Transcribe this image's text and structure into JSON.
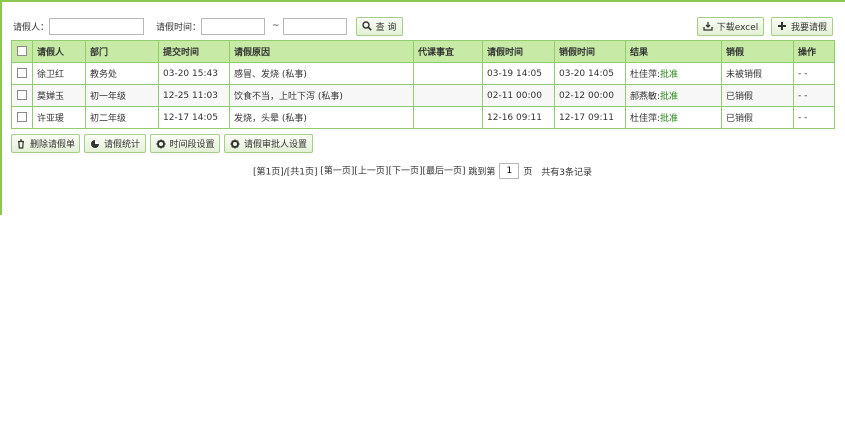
{
  "filter": {
    "applicant_label": "请假人：",
    "applicant_value": "",
    "time_label": "请假时间：",
    "time_separator": "~",
    "time_from_value": "",
    "time_to_value": "",
    "search_label": "查 询",
    "download_label": "下载excel",
    "apply_label": "我要请假"
  },
  "table": {
    "headers": [
      "请假人",
      "部门",
      "提交时间",
      "请假原因",
      "代课事宜",
      "请假时间",
      "销假时间",
      "结果",
      "销假",
      "操作"
    ],
    "rows": [
      {
        "name": "徐卫红",
        "dept": "教务处",
        "submit": "03-20 15:43",
        "reason": "感冒、发烧 (私事)",
        "sub": "",
        "start": "03-19 14:05",
        "end": "03-20 14:05",
        "result_by": "杜佳萍:",
        "result_status": "批准",
        "cancel": "未被销假",
        "op": "- -"
      },
      {
        "name": "莫婵玉",
        "dept": "初一年级",
        "submit": "12-25 11:03",
        "reason": "饮食不当，上吐下泻 (私事)",
        "sub": "",
        "start": "02-11 00:00",
        "end": "02-12 00:00",
        "result_by": "郝燕敏:",
        "result_status": "批准",
        "cancel": "已销假",
        "op": "- -"
      },
      {
        "name": "许亚瑗",
        "dept": "初二年级",
        "submit": "12-17 14:05",
        "reason": "发烧，头晕 (私事)",
        "sub": "",
        "start": "12-16 09:11",
        "end": "12-17 09:11",
        "result_by": "杜佳萍:",
        "result_status": "批准",
        "cancel": "已销假",
        "op": "- -"
      }
    ]
  },
  "actions": {
    "delete_label": "删除请假单",
    "stats_label": "请假统计",
    "period_label": "时间段设置",
    "approver_label": "请假审批人设置"
  },
  "pager": {
    "page_info": "[第1页]/[共1页]",
    "first": "[第一页]",
    "prev": "[上一页]",
    "next": "[下一页]",
    "last": "[最后一页]",
    "goto_label": "跳到第",
    "page_value": "1",
    "page_suffix": "页",
    "total": "共有3条记录"
  },
  "colors": {
    "accent": "#8cc850",
    "header_bg": "#c7eba6",
    "approved": "#2a8a1a"
  }
}
